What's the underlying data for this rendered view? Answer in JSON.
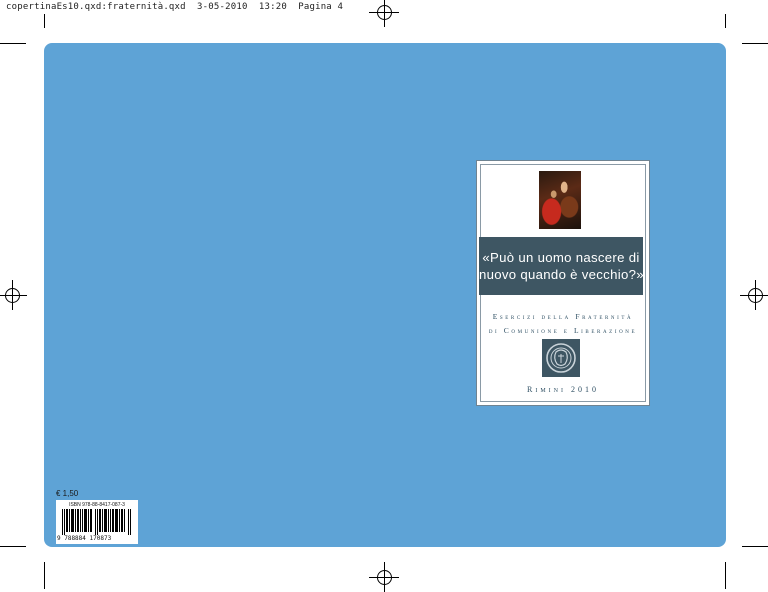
{
  "header": {
    "filename": "copertinaEs10.qxd:fraternità.qxd",
    "date": "3-05-2010",
    "time": "13:20",
    "page": "Pagina 4"
  },
  "cover": {
    "background_color": "#5ea3d6",
    "panel_color": "#3e5663",
    "title_line1": "«Può un uomo nascere di",
    "title_line2": "nuovo quando è vecchio?»",
    "subtitle_line1": "Esercizi della Fraternità",
    "subtitle_line2": "di Comunione e Liberazione",
    "place": "Rimini 2010"
  },
  "back": {
    "price": "€ 1,50",
    "isbn": "ISBN 978-88-8417-087-3",
    "barcode_digits": "9 788884 170873"
  }
}
